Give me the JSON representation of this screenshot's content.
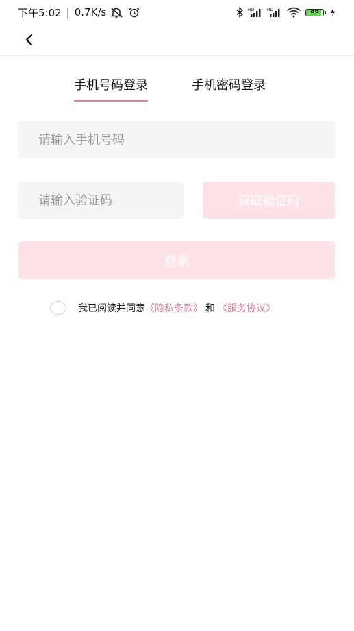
{
  "status_bar": {
    "time": "下午5:02",
    "separator": "|",
    "network_speed": "0.7K/s",
    "battery_level": "86",
    "icons": [
      "mute-icon",
      "alarm-icon",
      "bluetooth-icon",
      "signal-icon",
      "signal-icon",
      "wifi-icon",
      "battery-icon",
      "charging-icon"
    ],
    "battery_color": "#6ad05a"
  },
  "nav": {
    "back_icon": "chevron-left-icon"
  },
  "tabs": [
    {
      "label": "手机号码登录",
      "active": true
    },
    {
      "label": "手机密码登录",
      "active": false
    }
  ],
  "form": {
    "phone_placeholder": "请输入手机号码",
    "code_placeholder": "请输入验证码",
    "get_code_label": "获取验证码",
    "login_label": "登录"
  },
  "agreement": {
    "prefix": "我已阅读并同意",
    "privacy_link": "《隐私条款》",
    "conjunction": "和",
    "service_link": "《服务协议》"
  },
  "colors": {
    "accent": "#d9849a",
    "button_disabled": "#fde3e8",
    "input_bg": "#f5f5f5",
    "link": "#d4809a"
  }
}
